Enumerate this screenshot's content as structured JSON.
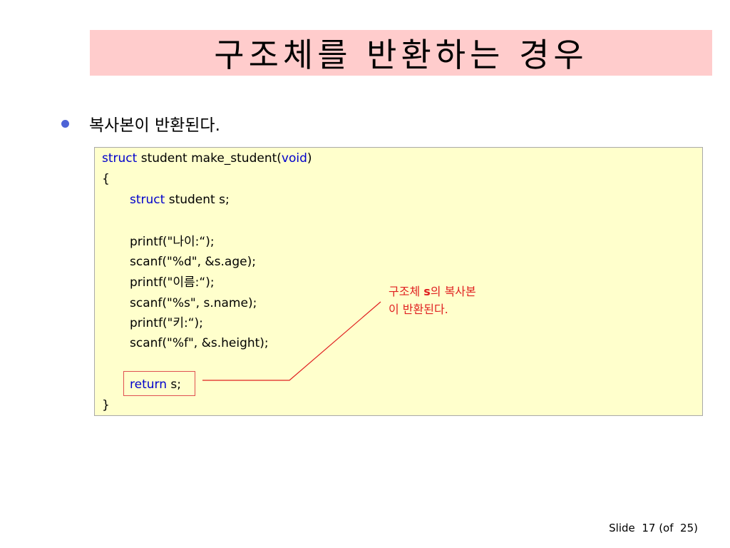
{
  "slide": {
    "title": "구조체를 반환하는 경우",
    "bullet": "복사본이 반환된다.",
    "footer": {
      "slide_label": "Slide",
      "current": "17",
      "of_label": "(of",
      "total": "25)"
    }
  },
  "code": {
    "line1": {
      "kw1": "struct",
      "mid": " student make_student(",
      "kw2": "void",
      "tail": ")"
    },
    "line2": "{",
    "line3": {
      "kw": "struct",
      "rest": " student s;"
    },
    "line4": "printf(\"나이:“);",
    "line5": "scanf(\"%d\", &s.age);",
    "line6": "printf(\"이름:“);",
    "line7": "scanf(\"%s\", s.name);",
    "line8": "printf(\"키:“);",
    "line9": "scanf(\"%f\", &s.height);",
    "line10": {
      "kw": "return",
      "rest": " s;"
    },
    "line11": "}"
  },
  "callout": {
    "line1_pre": "구조체 ",
    "var": "s",
    "line1_post": "의 복사본",
    "line2": "이 반환된다."
  },
  "colors": {
    "title_bg": "#ffcccc",
    "code_bg": "#ffffcc",
    "keyword": "#0000cc",
    "callout": "#e02020",
    "bullet": "#4d63d6"
  }
}
